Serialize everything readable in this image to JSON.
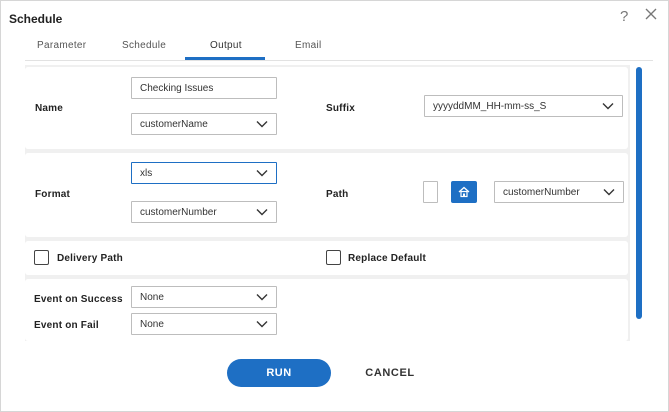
{
  "dialog": {
    "title": "Schedule",
    "help_glyph": "?"
  },
  "tabs": [
    {
      "label": "Parameter"
    },
    {
      "label": "Schedule"
    },
    {
      "label": "Output",
      "active": true
    },
    {
      "label": "Email"
    }
  ],
  "output": {
    "name_label": "Name",
    "name_value": "Checking Issues",
    "name_field_select": "customerName",
    "suffix_label": "Suffix",
    "suffix_value": "yyyyddMM_HH-mm-ss_S",
    "format_label": "Format",
    "format_value": "xls",
    "format_field_select": "customerNumber",
    "path_label": "Path",
    "path_value": "",
    "path_field_select": "customerNumber",
    "delivery_path_label": "Delivery Path",
    "delivery_path_checked": false,
    "replace_default_label": "Replace Default",
    "replace_default_checked": false,
    "event_success_label": "Event on Success",
    "event_success_value": "None",
    "event_fail_label": "Event on Fail",
    "event_fail_value": "None"
  },
  "footer": {
    "run_label": "RUN",
    "cancel_label": "CANCEL"
  },
  "colors": {
    "accent": "#1e6fc4",
    "panel_bg": "#f0f0f0"
  }
}
